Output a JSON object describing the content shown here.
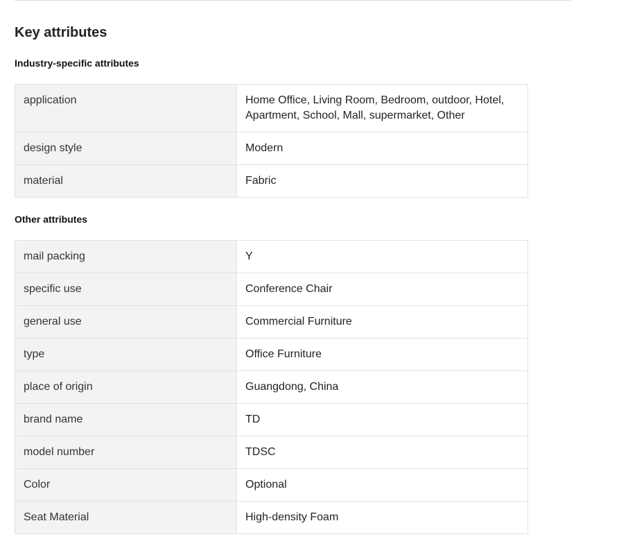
{
  "section_title": "Key attributes",
  "industry": {
    "title": "Industry-specific attributes",
    "rows": [
      {
        "key": "application",
        "value": "Home Office, Living Room, Bedroom, outdoor, Hotel, Apartment, School, Mall, supermarket, Other"
      },
      {
        "key": "design style",
        "value": "Modern"
      },
      {
        "key": "material",
        "value": "Fabric"
      }
    ]
  },
  "other": {
    "title": "Other attributes",
    "rows": [
      {
        "key": "mail packing",
        "value": "Y"
      },
      {
        "key": "specific use",
        "value": "Conference Chair"
      },
      {
        "key": "general use",
        "value": "Commercial Furniture"
      },
      {
        "key": "type",
        "value": "Office Furniture"
      },
      {
        "key": "place of origin",
        "value": "Guangdong, China"
      },
      {
        "key": "brand name",
        "value": "TD"
      },
      {
        "key": "model number",
        "value": "TDSC"
      },
      {
        "key": "Color",
        "value": "Optional"
      },
      {
        "key": "Seat Material",
        "value": "High-density Foam"
      }
    ]
  },
  "colors": {
    "key_cell_bg": "#f3f3f3",
    "border": "#e2e2e2",
    "text": "#222222"
  }
}
